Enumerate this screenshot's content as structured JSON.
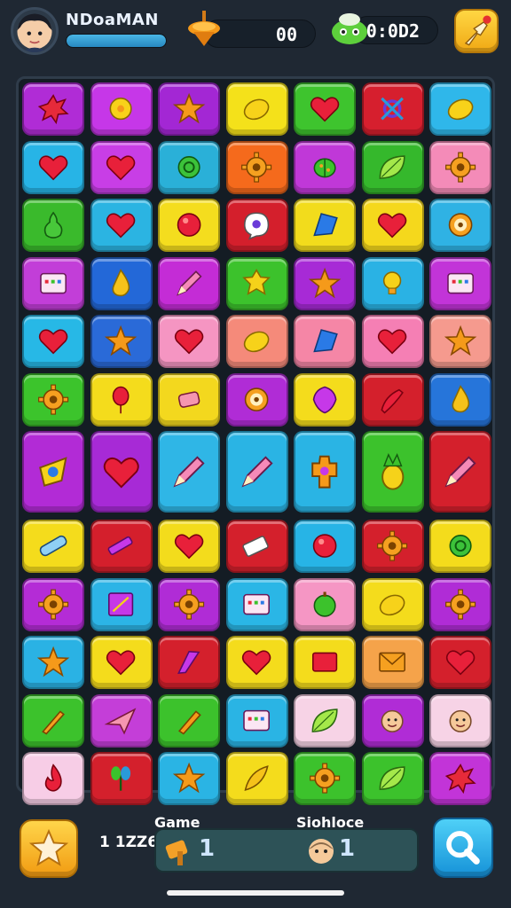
{
  "header": {
    "player_name": "NDoaMAN",
    "xp_progress": 1.0,
    "score": "00",
    "timer": "0:0D2",
    "pin_icon": "spinning-top-icon",
    "slime_icon": "green-slime-icon",
    "pointer_icon": "hand-pointer-icon"
  },
  "board": {
    "columns": 7,
    "rows": [
      [
        {
          "color": "#b02cd6",
          "icon": "splat"
        },
        {
          "color": "#c637e8",
          "icon": "flower"
        },
        {
          "color": "#a327d4",
          "icon": "star"
        },
        {
          "color": "#f4e11a",
          "icon": "lemon"
        },
        {
          "color": "#3ec42e",
          "icon": "heart"
        },
        {
          "color": "#d61f2e",
          "icon": "knot"
        },
        {
          "color": "#2fb7ea",
          "icon": "lemon"
        }
      ],
      [
        {
          "color": "#27b4e6",
          "icon": "heart"
        },
        {
          "color": "#c83ee6",
          "icon": "heart"
        },
        {
          "color": "#2ab0d8",
          "icon": "ring"
        },
        {
          "color": "#f56a1c",
          "icon": "gear"
        },
        {
          "color": "#c038d8",
          "icon": "beetle"
        },
        {
          "color": "#35b82c",
          "icon": "leaf"
        },
        {
          "color": "#f48bb8",
          "icon": "gear"
        }
      ],
      [
        {
          "color": "#3aba2c",
          "icon": "pear"
        },
        {
          "color": "#2bb4e2",
          "icon": "heart"
        },
        {
          "color": "#f4dd1e",
          "icon": "ball"
        },
        {
          "color": "#d41f2c",
          "icon": "bubble"
        },
        {
          "color": "#f2dc1c",
          "icon": "crystal"
        },
        {
          "color": "#f5d81c",
          "icon": "heart"
        },
        {
          "color": "#2fb2e4",
          "icon": "target"
        }
      ],
      [
        {
          "color": "#c23ed8",
          "icon": "panel"
        },
        {
          "color": "#2368d8",
          "icon": "drop"
        },
        {
          "color": "#c42cd6",
          "icon": "pencil"
        },
        {
          "color": "#3cc22c",
          "icon": "badge"
        },
        {
          "color": "#a72ad6",
          "icon": "star"
        },
        {
          "color": "#2ab2e4",
          "icon": "bulb"
        },
        {
          "color": "#c234d8",
          "icon": "panel"
        }
      ],
      [
        {
          "color": "#27b8e6",
          "icon": "heart"
        },
        {
          "color": "#2a6ad8",
          "icon": "star"
        },
        {
          "color": "#f595c2",
          "icon": "heart"
        },
        {
          "color": "#f58a7a",
          "icon": "lemon"
        },
        {
          "color": "#f586a6",
          "icon": "crystal"
        },
        {
          "color": "#f57fb4",
          "icon": "heart"
        },
        {
          "color": "#f59a8e",
          "icon": "star"
        }
      ],
      [
        {
          "color": "#3cc42c",
          "icon": "gear"
        },
        {
          "color": "#f4dc1c",
          "icon": "balloon"
        },
        {
          "color": "#f3d81e",
          "icon": "candy"
        },
        {
          "color": "#b02cd6",
          "icon": "target"
        },
        {
          "color": "#f4dc1c",
          "icon": "shield"
        },
        {
          "color": "#d4202c",
          "icon": "chili"
        },
        {
          "color": "#2675da",
          "icon": "drop"
        }
      ]
    ],
    "tall_row": [
      {
        "color": "#b22bd6",
        "icon": "spinner"
      },
      {
        "color": "#a72ad6",
        "icon": "heart"
      },
      {
        "color": "#2fb6e6",
        "icon": "pencil"
      },
      {
        "color": "#2ab4e4",
        "icon": "pencil"
      },
      {
        "color": "#2ab4e4",
        "icon": "cactus"
      },
      {
        "color": "#3cc22c",
        "icon": "pineapple"
      },
      {
        "color": "#d4202c",
        "icon": "pencil"
      }
    ],
    "rows_lower": [
      [
        {
          "color": "#f4dc1c",
          "icon": "bandage"
        },
        {
          "color": "#d41f2c",
          "icon": "crayon"
        },
        {
          "color": "#f3dc1c",
          "icon": "heart"
        },
        {
          "color": "#d4202c",
          "icon": "battery"
        },
        {
          "color": "#27b4e6",
          "icon": "ball"
        },
        {
          "color": "#d4202c",
          "icon": "gear"
        },
        {
          "color": "#f4dc1c",
          "icon": "ring"
        }
      ],
      [
        {
          "color": "#b42cd6",
          "icon": "gear"
        },
        {
          "color": "#2cb4e6",
          "icon": "frame"
        },
        {
          "color": "#b02cd6",
          "icon": "gear"
        },
        {
          "color": "#2ab6e6",
          "icon": "panel"
        },
        {
          "color": "#f596c4",
          "icon": "apple"
        },
        {
          "color": "#f4dc1c",
          "icon": "lemon"
        },
        {
          "color": "#b02cd6",
          "icon": "gear"
        }
      ],
      [
        {
          "color": "#2ab2e4",
          "icon": "star"
        },
        {
          "color": "#f4dc1c",
          "icon": "heart"
        },
        {
          "color": "#d4202c",
          "icon": "wing"
        },
        {
          "color": "#f4dc1c",
          "icon": "heart"
        },
        {
          "color": "#f4dc1c",
          "icon": "card"
        },
        {
          "color": "#f5a34a",
          "icon": "envelope"
        },
        {
          "color": "#d4202c",
          "icon": "heart"
        }
      ],
      [
        {
          "color": "#3cc22c",
          "icon": "brush"
        },
        {
          "color": "#c43ed8",
          "icon": "plane"
        },
        {
          "color": "#3cc22c",
          "icon": "carrot"
        },
        {
          "color": "#2ab4e4",
          "icon": "panel"
        },
        {
          "color": "#f7d3e6",
          "icon": "leaf"
        },
        {
          "color": "#b02cd6",
          "icon": "face"
        },
        {
          "color": "#f7d3e6",
          "icon": "face"
        }
      ],
      [
        {
          "color": "#f7cde6",
          "icon": "flame"
        },
        {
          "color": "#d4202c",
          "icon": "sprout"
        },
        {
          "color": "#2ab4e4",
          "icon": "star"
        },
        {
          "color": "#f4dc1c",
          "icon": "feather"
        },
        {
          "color": "#3cc22c",
          "icon": "gear"
        },
        {
          "color": "#3cc22c",
          "icon": "leaf"
        },
        {
          "color": "#c234d8",
          "icon": "splat"
        }
      ]
    ]
  },
  "footer": {
    "count": "1 1ZZ6",
    "game_label": "Game",
    "sub_label": "Siohloce",
    "left_value": "1",
    "right_value": "1",
    "star_icon": "star-icon",
    "search_icon": "search-icon"
  }
}
